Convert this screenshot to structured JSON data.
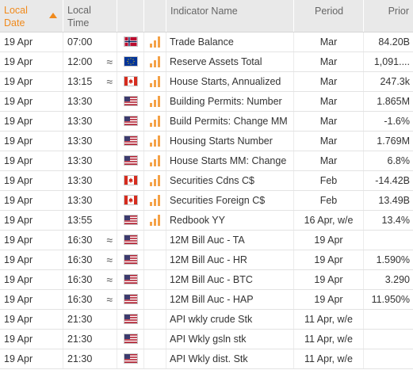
{
  "header": {
    "date_line1": "Local",
    "date_line2": "Date",
    "time_line1": "Local",
    "time_line2": "Time",
    "indicator": "Indicator Name",
    "period": "Period",
    "prior": "Prior"
  },
  "colors": {
    "accent": "#f08a1c",
    "bar_on": "#f4a146",
    "bar_off": "#dcdcdc"
  },
  "rows": [
    {
      "date": "19 Apr",
      "time": "07:00",
      "approx": "",
      "flag": "norway-flag",
      "importance": 3,
      "name": "Trade Balance",
      "period": "Mar",
      "prior": "84.20B"
    },
    {
      "date": "19 Apr",
      "time": "12:00",
      "approx": "≈",
      "flag": "eu-flag",
      "importance": 3,
      "name": "Reserve Assets Total",
      "period": "Mar",
      "prior": "1,091...."
    },
    {
      "date": "19 Apr",
      "time": "13:15",
      "approx": "≈",
      "flag": "canada-flag",
      "importance": 3,
      "name": "House Starts, Annualized",
      "period": "Mar",
      "prior": "247.3k"
    },
    {
      "date": "19 Apr",
      "time": "13:30",
      "approx": "",
      "flag": "us-flag",
      "importance": 3,
      "name": "Building Permits: Number",
      "period": "Mar",
      "prior": "1.865M"
    },
    {
      "date": "19 Apr",
      "time": "13:30",
      "approx": "",
      "flag": "us-flag",
      "importance": 3,
      "name": "Build Permits: Change MM",
      "period": "Mar",
      "prior": "-1.6%"
    },
    {
      "date": "19 Apr",
      "time": "13:30",
      "approx": "",
      "flag": "us-flag",
      "importance": 3,
      "name": "Housing Starts Number",
      "period": "Mar",
      "prior": "1.769M"
    },
    {
      "date": "19 Apr",
      "time": "13:30",
      "approx": "",
      "flag": "us-flag",
      "importance": 3,
      "name": "House Starts MM: Change",
      "period": "Mar",
      "prior": "6.8%"
    },
    {
      "date": "19 Apr",
      "time": "13:30",
      "approx": "",
      "flag": "canada-flag",
      "importance": 3,
      "name": "Securities Cdns C$",
      "period": "Feb",
      "prior": "-14.42B"
    },
    {
      "date": "19 Apr",
      "time": "13:30",
      "approx": "",
      "flag": "canada-flag",
      "importance": 3,
      "name": "Securities Foreign C$",
      "period": "Feb",
      "prior": "13.49B"
    },
    {
      "date": "19 Apr",
      "time": "13:55",
      "approx": "",
      "flag": "us-flag",
      "importance": 3,
      "name": "Redbook YY",
      "period": "16 Apr, w/e",
      "prior": "13.4%"
    },
    {
      "date": "19 Apr",
      "time": "16:30",
      "approx": "≈",
      "flag": "us-flag",
      "importance": 0,
      "name": "12M Bill Auc - TA",
      "period": "19 Apr",
      "prior": ""
    },
    {
      "date": "19 Apr",
      "time": "16:30",
      "approx": "≈",
      "flag": "us-flag",
      "importance": 0,
      "name": "12M Bill Auc - HR",
      "period": "19 Apr",
      "prior": "1.590%"
    },
    {
      "date": "19 Apr",
      "time": "16:30",
      "approx": "≈",
      "flag": "us-flag",
      "importance": 0,
      "name": "12M Bill Auc - BTC",
      "period": "19 Apr",
      "prior": "3.290"
    },
    {
      "date": "19 Apr",
      "time": "16:30",
      "approx": "≈",
      "flag": "us-flag",
      "importance": 0,
      "name": "12M Bill Auc - HAP",
      "period": "19 Apr",
      "prior": "11.950%"
    },
    {
      "date": "19 Apr",
      "time": "21:30",
      "approx": "",
      "flag": "us-flag",
      "importance": 0,
      "name": "API wkly crude Stk",
      "period": "11 Apr, w/e",
      "prior": ""
    },
    {
      "date": "19 Apr",
      "time": "21:30",
      "approx": "",
      "flag": "us-flag",
      "importance": 0,
      "name": "API Wkly gsln stk",
      "period": "11 Apr, w/e",
      "prior": ""
    },
    {
      "date": "19 Apr",
      "time": "21:30",
      "approx": "",
      "flag": "us-flag",
      "importance": 0,
      "name": "API Wkly dist. Stk",
      "period": "11 Apr, w/e",
      "prior": ""
    }
  ]
}
